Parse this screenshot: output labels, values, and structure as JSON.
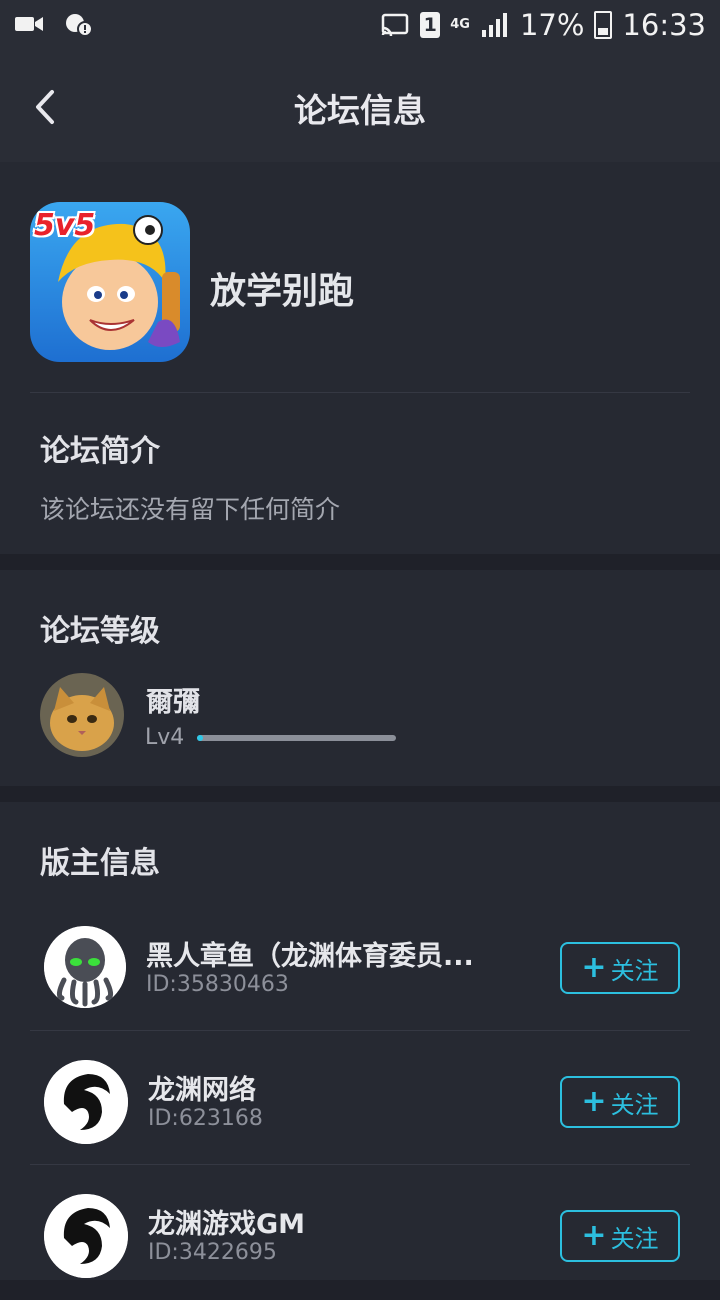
{
  "status_bar": {
    "sim_slot": "1",
    "network": "4G",
    "battery": "17%",
    "time": "16:33",
    "icons": [
      "video-icon",
      "notification-icon",
      "cast-icon",
      "signal-icon",
      "battery-icon"
    ]
  },
  "header": {
    "title": "论坛信息",
    "back_icon": "chevron-left-icon"
  },
  "forum": {
    "name": "放学别跑",
    "icon_badge": "5v5"
  },
  "intro": {
    "title": "论坛简介",
    "text": "该论坛还没有留下任何简介"
  },
  "level": {
    "title": "论坛等级",
    "user_name": "爾彌",
    "level_label": "Lv4",
    "progress": 0.03
  },
  "moderators": {
    "title": "版主信息",
    "follow_label": "关注",
    "items": [
      {
        "name": "黑人章鱼（龙渊体育委员...",
        "id": "ID:35830463"
      },
      {
        "name": "龙渊网络",
        "id": "ID:623168"
      },
      {
        "name": "龙渊游戏GM",
        "id": "ID:3422695"
      }
    ]
  },
  "colors": {
    "background": "#1f2129",
    "card": "#262932",
    "bar": "#2a2d36",
    "accent": "#2cbfdf"
  }
}
